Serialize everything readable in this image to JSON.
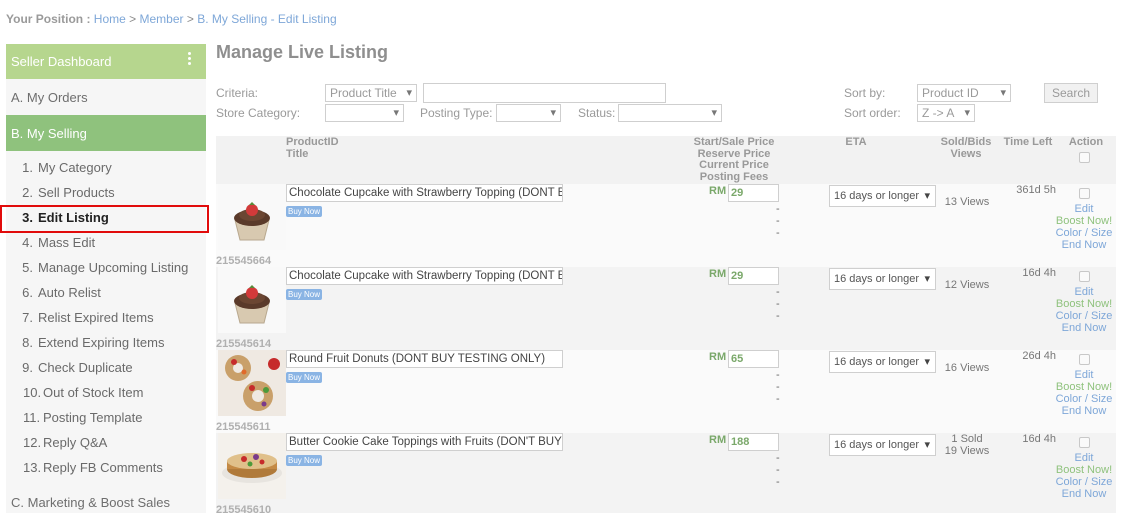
{
  "breadcrumb": {
    "prefix": "Your Position :",
    "home": "Home",
    "sep": ">",
    "member": "Member",
    "current": "B. My Selling - Edit Listing"
  },
  "sidebar": {
    "dashboard": "Seller Dashboard",
    "orders": "A. My Orders",
    "selling": "B. My Selling",
    "items": [
      {
        "num": "1.",
        "label": "My Category"
      },
      {
        "num": "2.",
        "label": "Sell Products"
      },
      {
        "num": "3.",
        "label": "Edit Listing"
      },
      {
        "num": "4.",
        "label": "Mass Edit"
      },
      {
        "num": "5.",
        "label": "Manage Upcoming Listing"
      },
      {
        "num": "6.",
        "label": "Auto Relist"
      },
      {
        "num": "7.",
        "label": "Relist Expired Items"
      },
      {
        "num": "8.",
        "label": "Extend Expiring Items"
      },
      {
        "num": "9.",
        "label": "Check Duplicate"
      },
      {
        "num": "10.",
        "label": "Out of Stock Item"
      },
      {
        "num": "11.",
        "label": "Posting Template"
      },
      {
        "num": "12.",
        "label": "Reply Q&A"
      },
      {
        "num": "13.",
        "label": "Reply FB Comments"
      }
    ],
    "marketing": "C. Marketing & Boost Sales"
  },
  "main": {
    "title": "Manage Live Listing",
    "filters": {
      "criteria_label": "Criteria:",
      "criteria_value": "Product Title",
      "store_category_label": "Store Category:",
      "posting_type_label": "Posting Type:",
      "status_label": "Status:",
      "sort_by_label": "Sort by:",
      "sort_by_value": "Product ID",
      "sort_order_label": "Sort order:",
      "sort_order_value": "Z -> A",
      "search_button": "Search"
    },
    "table_headers": {
      "product": "ProductID\nTitle",
      "price": "Start/Sale Price\nReserve Price\nCurrent Price\nPosting Fees",
      "eta": "ETA",
      "sold": "Sold/Bids\nViews",
      "time_left": "Time Left",
      "action": "Action"
    },
    "rows": [
      {
        "id": "215545664",
        "title": "Chocolate Cupcake with Strawberry Topping (DONT BUY TESTING ONLY)",
        "badge": "Buy Now",
        "currency": "RM",
        "price": "29",
        "eta": "16 days or longer",
        "sold": "",
        "views": "13 Views",
        "time_left": "361d 5h",
        "image": "cupcake"
      },
      {
        "id": "215545614",
        "title": "Chocolate Cupcake with Strawberry Topping (DONT BUY TESTING ONLY)",
        "badge": "Buy Now",
        "currency": "RM",
        "price": "29",
        "eta": "16 days or longer",
        "sold": "",
        "views": "12 Views",
        "time_left": "16d 4h",
        "image": "cupcake"
      },
      {
        "id": "215545611",
        "title": "Round Fruit Donuts (DONT BUY TESTING ONLY)",
        "badge": "Buy Now",
        "currency": "RM",
        "price": "65",
        "eta": "16 days or longer",
        "sold": "",
        "views": "16 Views",
        "time_left": "26d 4h",
        "image": "donuts"
      },
      {
        "id": "215545610",
        "title": "Butter Cookie Cake Toppings with Fruits (DON'T BUY TESTING ONLY)",
        "badge": "Buy Now",
        "currency": "RM",
        "price": "188",
        "eta": "16 days or longer",
        "sold": "1 Sold",
        "views": "19 Views",
        "time_left": "16d 4h",
        "image": "cake"
      }
    ],
    "actions": {
      "edit": "Edit",
      "boost": "Boost Now!",
      "color_size": "Color / Size",
      "end": "End Now"
    },
    "colors": {
      "dashboard_green": "#b6d68e",
      "active_green": "#8fc27d",
      "link_blue": "#7ea7d8",
      "highlight_red": "#e10b0b"
    }
  }
}
